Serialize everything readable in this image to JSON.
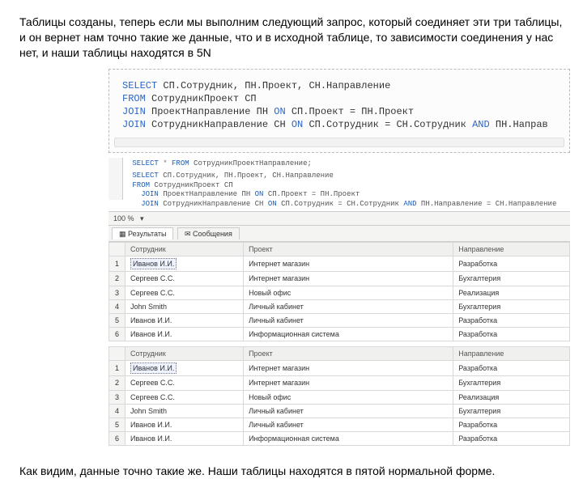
{
  "intro": "Таблицы созданы, теперь если мы выполним следующий запрос, который соединяет эти три таблицы, и он вернет нам точно такие же данные, что и в исходной таблице, то зависимости соединения у нас нет, и наши таблицы находятся в 5N",
  "codebox": {
    "l1a": "SELECT",
    "l1b": " СП.Сотрудник, ПН.Проект, СН.Направление",
    "l2a": "FROM",
    "l2b": " СотрудникПроект СП",
    "l3a": "JOIN",
    "l3b": " ПроектНаправление ПН ",
    "l3c": "ON",
    "l3d": " СП.Проект = ПН.Проект",
    "l4a": "JOIN",
    "l4b": " СотрудникНаправление СН ",
    "l4c": "ON",
    "l4d": " СП.Сотрудник = СН.Сотрудник ",
    "l4e": "AND",
    "l4f": " ПН.Направ"
  },
  "editor": {
    "l1": "SELECT * FROM СотрудникПроектНаправление;",
    "l2": "SELECT СП.Сотрудник, ПН.Проект, СН.Направление",
    "l3": "FROM СотрудникПроект СП",
    "l4": "JOIN ПроектНаправление ПН ON СП.Проект = ПН.Проект",
    "l5": "JOIN СотрудникНаправление СН ON СП.Сотрудник = СН.Сотрудник AND ПН.Направление = СН.Направление"
  },
  "zoom": "100 %",
  "tabs": {
    "results": "Результаты",
    "messages": "Сообщения"
  },
  "headers": {
    "h1": "Сотрудник",
    "h2": "Проект",
    "h3": "Направление"
  },
  "rows1": [
    {
      "n": "1",
      "a": "Иванов И.И.",
      "b": "Интернет магазин",
      "c": "Разработка"
    },
    {
      "n": "2",
      "a": "Сергеев С.С.",
      "b": "Интернет магазин",
      "c": "Бухгалтерия"
    },
    {
      "n": "3",
      "a": "Сергеев С.С.",
      "b": "Новый офис",
      "c": "Реализация"
    },
    {
      "n": "4",
      "a": "John Smith",
      "b": "Личный кабинет",
      "c": "Бухгалтерия"
    },
    {
      "n": "5",
      "a": "Иванов И.И.",
      "b": "Личный кабинет",
      "c": "Разработка"
    },
    {
      "n": "6",
      "a": "Иванов И.И.",
      "b": "Информационная система",
      "c": "Разработка"
    }
  ],
  "rows2": [
    {
      "n": "1",
      "a": "Иванов И.И.",
      "b": "Интернет магазин",
      "c": "Разработка"
    },
    {
      "n": "2",
      "a": "Сергеев С.С.",
      "b": "Интернет магазин",
      "c": "Бухгалтерия"
    },
    {
      "n": "3",
      "a": "Сергеев С.С.",
      "b": "Новый офис",
      "c": "Реализация"
    },
    {
      "n": "4",
      "a": "John Smith",
      "b": "Личный кабинет",
      "c": "Бухгалтерия"
    },
    {
      "n": "5",
      "a": "Иванов И.И.",
      "b": "Личный кабинет",
      "c": "Разработка"
    },
    {
      "n": "6",
      "a": "Иванов И.И.",
      "b": "Информационная система",
      "c": "Разработка"
    }
  ],
  "outro": "Как видим, данные точно такие же. Наши таблицы находятся в пятой нормальной форме."
}
